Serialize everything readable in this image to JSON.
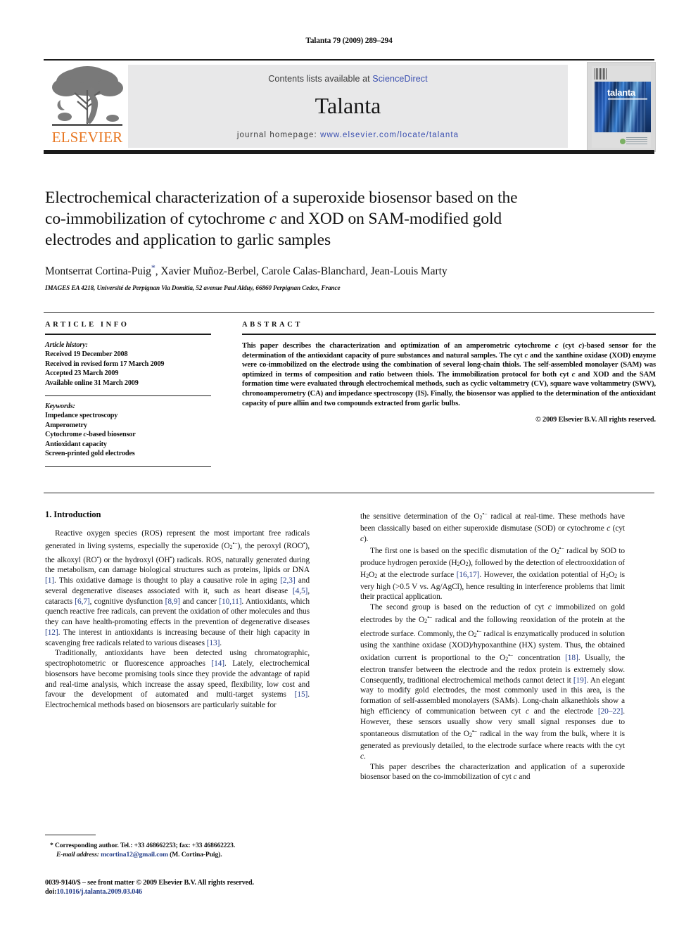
{
  "running_head": "Talanta 79 (2009) 289–294",
  "masthead": {
    "contents_prefix": "Contents lists available at ",
    "sciencedirect": "ScienceDirect",
    "journal_name": "Talanta",
    "homepage_prefix": "journal homepage: ",
    "homepage_url": "www.elsevier.com/locate/talanta",
    "publisher_logo_text": "ELSEVIER",
    "cover_title": "talanta",
    "link_color": "#3a4fb0",
    "elsevier_orange": "#E87722"
  },
  "article": {
    "title_line1": "Electrochemical characterization of a superoxide biosensor based on the",
    "title_line2_a": "co-immobilization of cytochrome ",
    "title_line2_italic": "c",
    "title_line2_b": " and XOD on SAM-modified gold",
    "title_line3": "electrodes and application to garlic samples",
    "authors": "Montserrat Cortina-Puig*, Xavier Muñoz-Berbel, Carole Calas-Blanchard, Jean-Louis Marty",
    "affiliation": "IMAGES EA 4218, Université de Perpignan Via Domitia, 52 avenue Paul Alduy, 66860 Perpignan Cedex, France"
  },
  "info": {
    "heading": "ARTICLE INFO",
    "history_label": "Article history:",
    "history": [
      "Received 19 December 2008",
      "Received in revised form 17 March 2009",
      "Accepted 23 March 2009",
      "Available online 31 March 2009"
    ],
    "keywords_label": "Keywords:",
    "keywords": [
      "Impedance spectroscopy",
      "Amperometry",
      "Cytochrome c-based biosensor",
      "Antioxidant capacity",
      "Screen-printed gold electrodes"
    ]
  },
  "abstract": {
    "heading": "ABSTRACT",
    "text": "This paper describes the characterization and optimization of an amperometric cytochrome c (cyt c)-based sensor for the determination of the antioxidant capacity of pure substances and natural samples. The cyt c and the xanthine oxidase (XOD) enzyme were co-immobilized on the electrode using the combination of several long-chain thiols. The self-assembled monolayer (SAM) was optimized in terms of composition and ratio between thiols. The immobilization protocol for both cyt c and XOD and the SAM formation time were evaluated through electrochemical methods, such as cyclic voltammetry (CV), square wave voltammetry (SWV), chronoamperometry (CA) and impedance spectroscopy (IS). Finally, the biosensor was applied to the determination of the antioxidant capacity of pure alliin and two compounds extracted from garlic bulbs.",
    "copyright": "© 2009 Elsevier B.V. All rights reserved."
  },
  "body": {
    "section_title": "1. Introduction",
    "left_p1": "Reactive oxygen species (ROS) represent the most important free radicals generated in living systems, especially the superoxide (O2•−), the peroxyl (ROO•), the alkoxyl (RO•) or the hydroxyl (OH•) radicals. ROS, naturally generated during the metabolism, can damage biological structures such as proteins, lipids or DNA [1]. This oxidative damage is thought to play a causative role in aging [2,3] and several degenerative diseases associated with it, such as heart disease [4,5], cataracts [6,7], cognitive dysfunction [8,9] and cancer [10,11]. Antioxidants, which quench reactive free radicals, can prevent the oxidation of other molecules and thus they can have health-promoting effects in the prevention of degenerative diseases [12]. The interest in antioxidants is increasing because of their high capacity in scavenging free radicals related to various diseases [13].",
    "left_p2": "Traditionally, antioxidants have been detected using chromatographic, spectrophotometric or fluorescence approaches [14]. Lately, electrochemical biosensors have become promising tools since they provide the advantage of rapid and real-time analysis, which increase the assay speed, flexibility, low cost and favour the development of automated and multi-target systems [15]. Electrochemical methods based on biosensors are particularly suitable for",
    "right_p1": "the sensitive determination of the O2•− radical at real-time. These methods have been classically based on either superoxide dismutase (SOD) or cytochrome c (cyt c).",
    "right_p2": "The first one is based on the specific dismutation of the O2•− radical by SOD to produce hydrogen peroxide (H2O2), followed by the detection of electrooxidation of H2O2 at the electrode surface [16,17]. However, the oxidation potential of H2O2 is very high (>0.5 V vs. Ag/AgCl), hence resulting in interference problems that limit their practical application.",
    "right_p3": "The second group is based on the reduction of cyt c immobilized on gold electrodes by the O2•− radical and the following reoxidation of the protein at the electrode surface. Commonly, the O2•− radical is enzymatically produced in solution using the xanthine oxidase (XOD)/hypoxanthine (HX) system. Thus, the obtained oxidation current is proportional to the O2•− concentration [18]. Usually, the electron transfer between the electrode and the redox protein is extremely slow. Consequently, traditional electrochemical methods cannot detect it [19]. An elegant way to modify gold electrodes, the most commonly used in this area, is the formation of self-assembled monolayers (SAMs). Long-chain alkanethiols show a high efficiency of communication between cyt c and the electrode [20–22]. However, these sensors usually show very small signal responses due to spontaneous dismutation of the O2•− radical in the way from the bulk, where it is generated as previously detailed, to the electrode surface where reacts with the cyt c.",
    "right_p4": "This paper describes the characterization and application of a superoxide biosensor based on the co-immobilization of cyt c and"
  },
  "footnote": {
    "corresponding": "* Corresponding author. Tel.: +33 468662253; fax: +33 468662223.",
    "email_label": "E-mail address:",
    "email": "mcortina12@gmail.com",
    "email_owner": "(M. Cortina-Puig)."
  },
  "imprint": {
    "line1": "0039-9140/$ – see front matter © 2009 Elsevier B.V. All rights reserved.",
    "doi_label": "doi:",
    "doi": "10.1016/j.talanta.2009.03.046"
  }
}
